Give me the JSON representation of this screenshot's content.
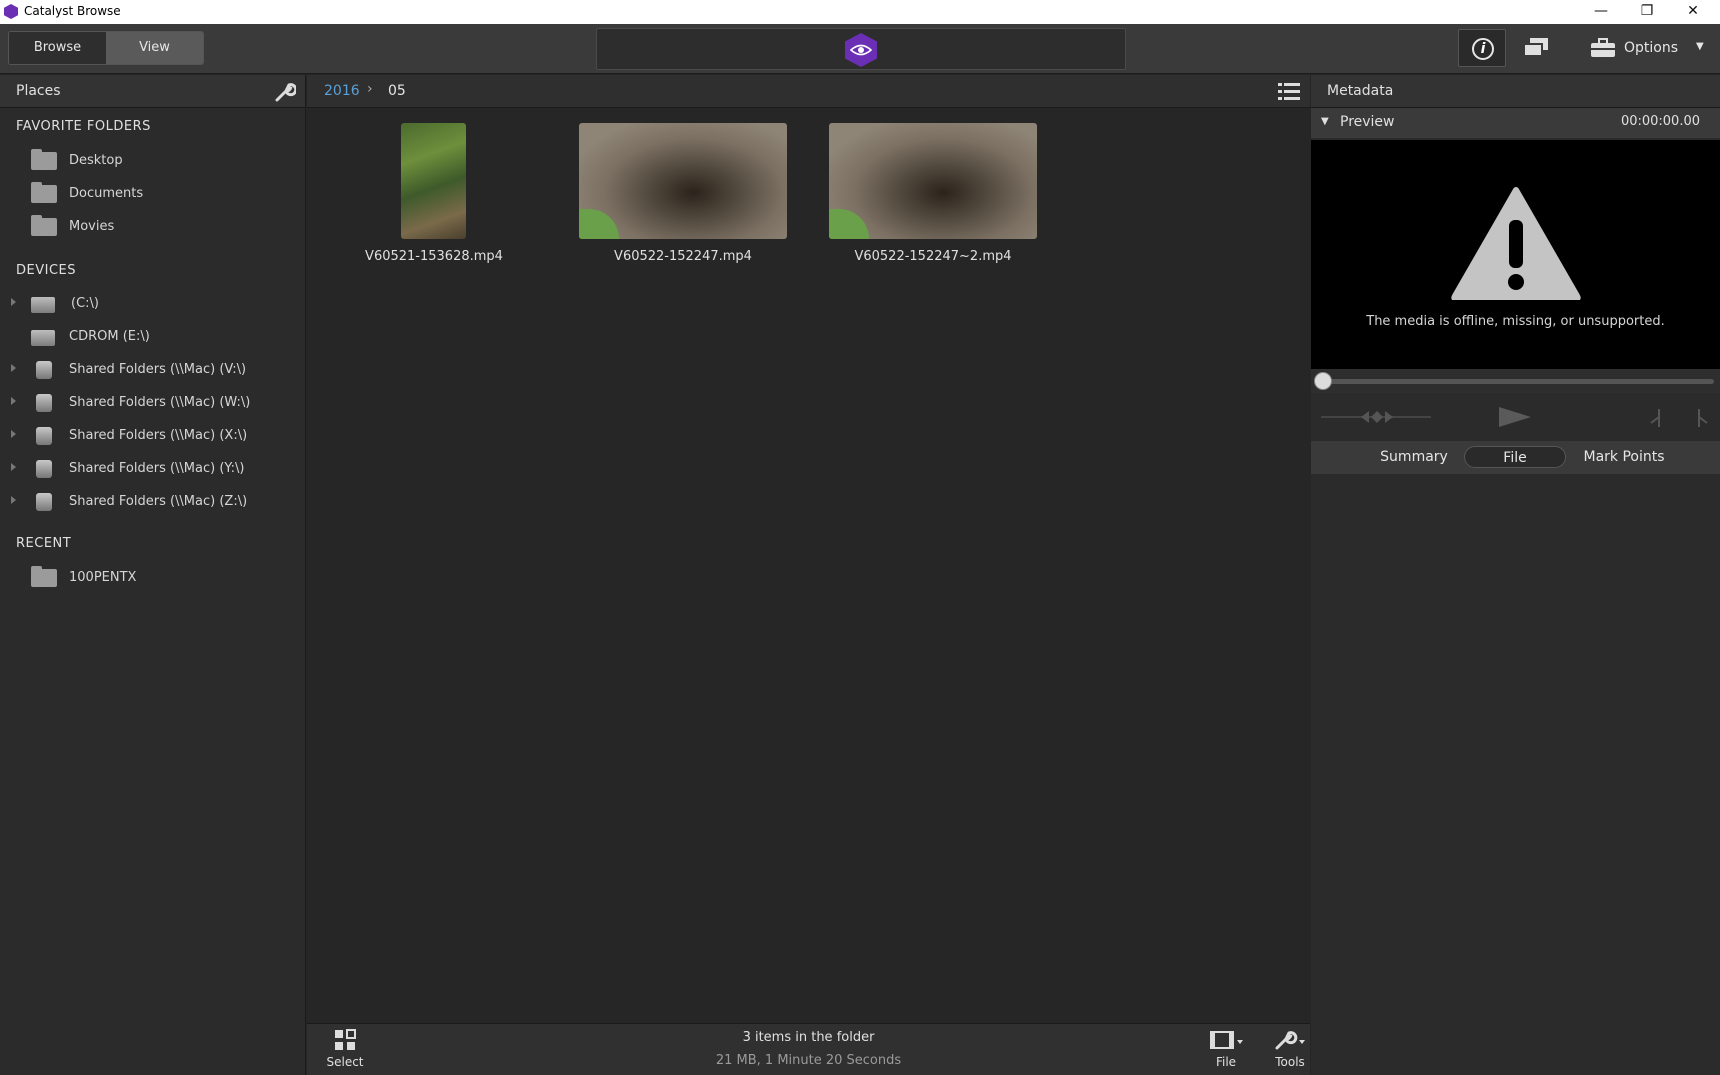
{
  "window": {
    "title": "Catalyst Browse",
    "minimize": "—",
    "restore": "❐",
    "close": "✕"
  },
  "toolbar": {
    "browse_label": "Browse",
    "view_label": "View",
    "options_label": "Options",
    "accent": "#6b2fb5"
  },
  "places": {
    "title": "Places",
    "favorites_header": "FAVORITE FOLDERS",
    "favorites": [
      "Desktop",
      "Documents",
      "Movies"
    ],
    "devices_header": "DEVICES",
    "devices": [
      "(C:\\)",
      "CDROM (E:\\)",
      "Shared Folders (\\\\Mac) (V:\\)",
      "Shared Folders (\\\\Mac) (W:\\)",
      "Shared Folders (\\\\Mac) (X:\\)",
      "Shared Folders (\\\\Mac) (Y:\\)",
      "Shared Folders (\\\\Mac) (Z:\\)"
    ],
    "recent_header": "RECENT",
    "recent": [
      "100PENTX"
    ]
  },
  "breadcrumb": {
    "parent": "2016",
    "current": "05"
  },
  "files": [
    "V60521-153628.mp4",
    "V60522-152247.mp4",
    "V60522-152247~2.mp4"
  ],
  "status": {
    "count": "3 items in the folder",
    "summary": "21 MB, 1 Minute 20 Seconds"
  },
  "bottom_bar": {
    "select_label": "Select",
    "file_label": "File",
    "tools_label": "Tools"
  },
  "metadata": {
    "title": "Metadata",
    "preview_label": "Preview",
    "timecode": "00:00:00.00",
    "warning": "The media is offline, missing, or unsupported.",
    "tabs": [
      "Summary",
      "File",
      "Mark Points"
    ],
    "active_tab": "File"
  }
}
